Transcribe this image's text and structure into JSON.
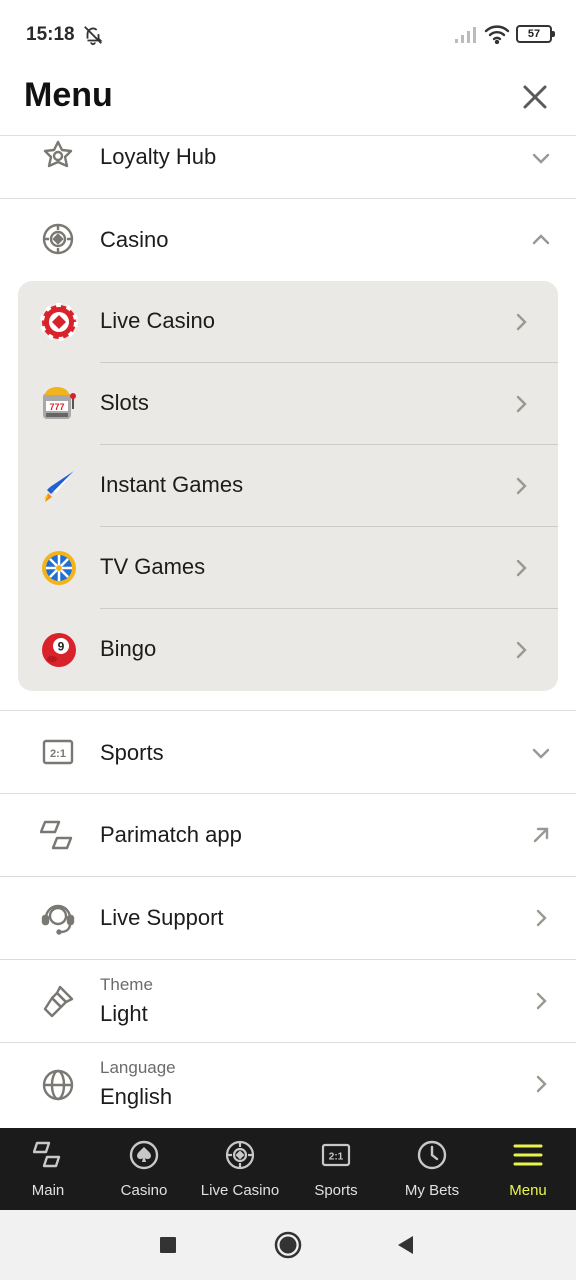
{
  "status_bar": {
    "time": "15:18",
    "battery": "57"
  },
  "header": {
    "title": "Menu"
  },
  "menu": {
    "loyalty": {
      "label": "Loyalty Hub"
    },
    "casino": {
      "label": "Casino",
      "items": [
        {
          "label": "Live Casino"
        },
        {
          "label": "Slots"
        },
        {
          "label": "Instant Games"
        },
        {
          "label": "TV Games"
        },
        {
          "label": "Bingo"
        }
      ]
    },
    "sports": {
      "label": "Sports",
      "icon_text": "2:1"
    },
    "app": {
      "label": "Parimatch app"
    },
    "support": {
      "label": "Live Support"
    },
    "theme": {
      "caption": "Theme",
      "value": "Light"
    },
    "language": {
      "caption": "Language",
      "value": "English"
    }
  },
  "bottom_nav": [
    {
      "label": "Main"
    },
    {
      "label": "Casino"
    },
    {
      "label": "Live Casino"
    },
    {
      "label": "Sports",
      "icon_text": "2:1"
    },
    {
      "label": "My Bets"
    },
    {
      "label": "Menu"
    }
  ],
  "colors": {
    "accent": "#e8f64b",
    "nav_bg": "#1b1b1b",
    "submenu_bg": "#ebe9e6",
    "icon_gray": "#7a7872"
  }
}
